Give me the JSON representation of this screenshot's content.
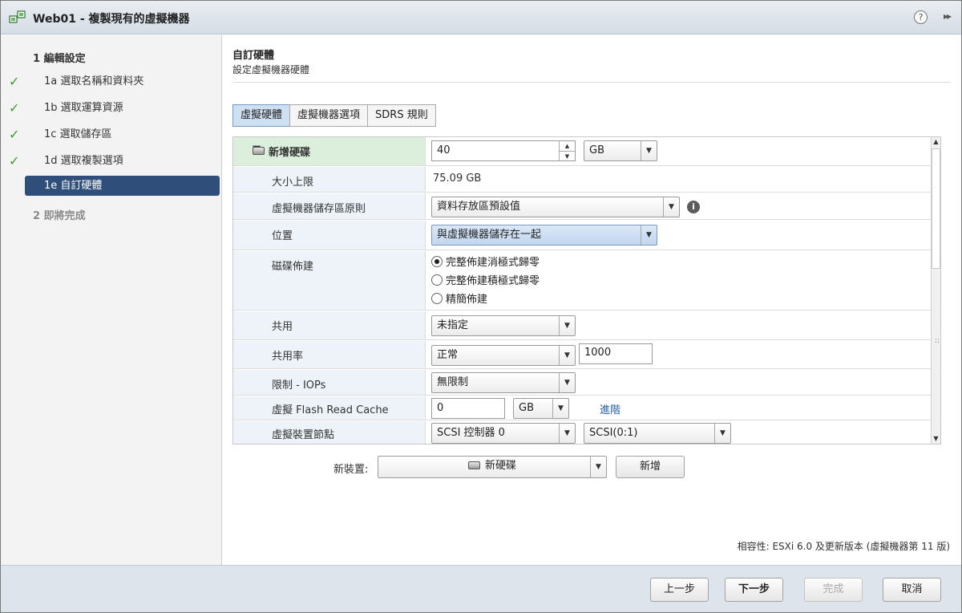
{
  "window": {
    "title": "Web01 - 複製現有的虛擬機器",
    "help": "?",
    "expand": "▸▸"
  },
  "sidebar": {
    "section1": "1 編輯設定",
    "items": [
      {
        "check": "✓",
        "label": "1a 選取名稱和資料夾"
      },
      {
        "check": "✓",
        "label": "1b 選取運算資源"
      },
      {
        "check": "✓",
        "label": "1c 選取儲存區"
      },
      {
        "check": "✓",
        "label": "1d 選取複製選項"
      },
      {
        "check": "",
        "label": "1e 自訂硬體"
      }
    ],
    "section2": "2 即將完成"
  },
  "main": {
    "title": "自訂硬體",
    "subtitle": "設定虛擬機器硬體",
    "tabs": [
      {
        "label": "虛擬硬體",
        "active": true
      },
      {
        "label": "虛擬機器選項",
        "active": false
      },
      {
        "label": "SDRS 規則",
        "active": false
      }
    ],
    "disk": {
      "header": "新增硬碟",
      "size_value": "40",
      "size_unit": "GB",
      "rows": {
        "max_size": {
          "label": "大小上限",
          "value": "75.09 GB"
        },
        "policy": {
          "label": "虛擬機器儲存區原則",
          "value": "資料存放區預設值"
        },
        "location": {
          "label": "位置",
          "value": "與虛擬機器儲存在一起"
        },
        "provisioning": {
          "label": "磁碟佈建",
          "options": [
            "完整佈建消極式歸零",
            "完整佈建積極式歸零",
            "精簡佈建"
          ],
          "selected_index": 0
        },
        "shares": {
          "label": "共用",
          "value": "未指定"
        },
        "share_rate": {
          "label": "共用率",
          "value": "正常",
          "number": "1000"
        },
        "iops": {
          "label": "限制 - IOPs",
          "value": "無限制"
        },
        "flash": {
          "label": "虛擬 Flash Read Cache",
          "value": "0",
          "unit": "GB",
          "advanced": "進階"
        },
        "node": {
          "label": "虛擬裝置節點",
          "controller": "SCSI 控制器 0",
          "slot": "SCSI(0:1)"
        }
      }
    },
    "new_device": {
      "label": "新裝置:",
      "value": "新硬碟",
      "add": "新增"
    },
    "compat": "相容性: ESXi 6.0 及更新版本 (虛擬機器第 11 版)"
  },
  "footer": {
    "back": "上一步",
    "next": "下一步",
    "finish": "完成",
    "cancel": "取消"
  }
}
